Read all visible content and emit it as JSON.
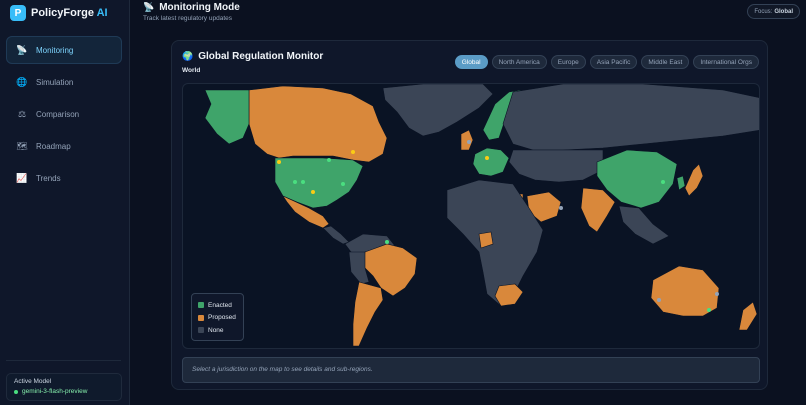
{
  "app": {
    "brand_main": "PolicyForge",
    "brand_accent": " AI",
    "logo_letter": "P"
  },
  "sidebar": {
    "items": [
      {
        "label": "Monitoring",
        "icon": "satellite-icon",
        "glyph": "📡",
        "active": true
      },
      {
        "label": "Simulation",
        "icon": "globe-icon",
        "glyph": "🌐",
        "active": false
      },
      {
        "label": "Comparison",
        "icon": "scales-icon",
        "glyph": "⚖",
        "active": false
      },
      {
        "label": "Roadmap",
        "icon": "map-icon",
        "glyph": "🗺",
        "active": false
      },
      {
        "label": "Trends",
        "icon": "chart-icon",
        "glyph": "📈",
        "active": false
      }
    ],
    "model": {
      "label": "Active Model",
      "value": "gemini-3-flash-preview"
    }
  },
  "header": {
    "title": "Monitoring Mode",
    "subtitle": "Track latest regulatory updates",
    "focus_label": "Focus:",
    "focus_value": "Global"
  },
  "panel": {
    "title": "Global Regulation Monitor",
    "subtitle": "World",
    "tabs": [
      {
        "label": "Global",
        "active": true
      },
      {
        "label": "North America",
        "active": false
      },
      {
        "label": "Europe",
        "active": false
      },
      {
        "label": "Asia Pacific",
        "active": false
      },
      {
        "label": "Middle East",
        "active": false
      },
      {
        "label": "International Orgs",
        "active": false
      }
    ],
    "legend": [
      {
        "label": "Enacted",
        "color": "#3fa46a"
      },
      {
        "label": "Proposed",
        "color": "#d9883b"
      },
      {
        "label": "None",
        "color": "#3b4556"
      }
    ],
    "info": "Select a jurisdiction on the map to see details and sub-regions."
  },
  "colors": {
    "enacted": "#3fa46a",
    "proposed": "#d9883b",
    "none": "#3b4556",
    "accent": "#38bdf8"
  }
}
